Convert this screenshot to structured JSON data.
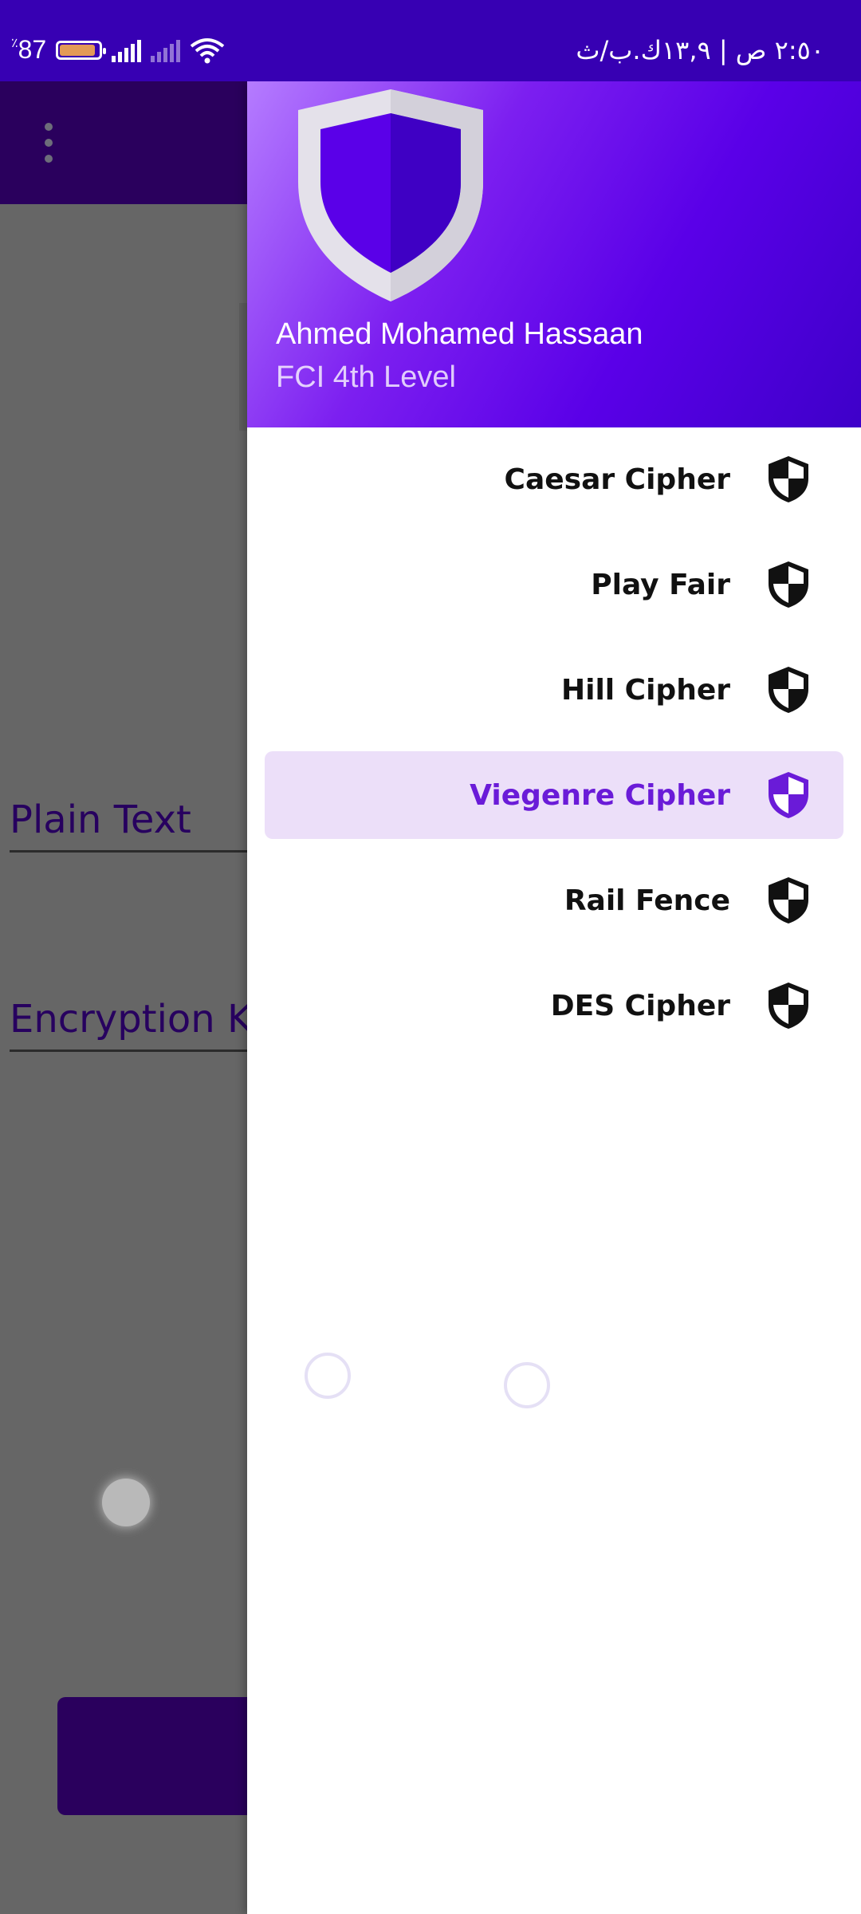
{
  "status_bar": {
    "battery_percent": "87",
    "battery_suffix": "٪",
    "right_text": "٢:٥٠ ص | ١٣,٩ك.ب/ث"
  },
  "background_form": {
    "plain_text_label": "Plain Text",
    "encryption_key_label": "Encryption Ke"
  },
  "drawer": {
    "header": {
      "user_name": "Ahmed Mohamed Hassaan",
      "user_level": "FCI 4th Level"
    },
    "items": [
      {
        "label": "Caesar Cipher",
        "icon": "shield-icon",
        "selected": false
      },
      {
        "label": "Play Fair",
        "icon": "shield-icon",
        "selected": false
      },
      {
        "label": "Hill Cipher",
        "icon": "shield-icon",
        "selected": false
      },
      {
        "label": "Viegenre Cipher",
        "icon": "shield-icon",
        "selected": true
      },
      {
        "label": "Rail Fence",
        "icon": "shield-icon",
        "selected": false
      },
      {
        "label": "DES Cipher",
        "icon": "shield-icon",
        "selected": false
      }
    ]
  },
  "colors": {
    "status_bar": "#3700b3",
    "app_bar": "#2a005d",
    "accent": "#6a1bd8",
    "selected_bg": "#ecdff9"
  }
}
